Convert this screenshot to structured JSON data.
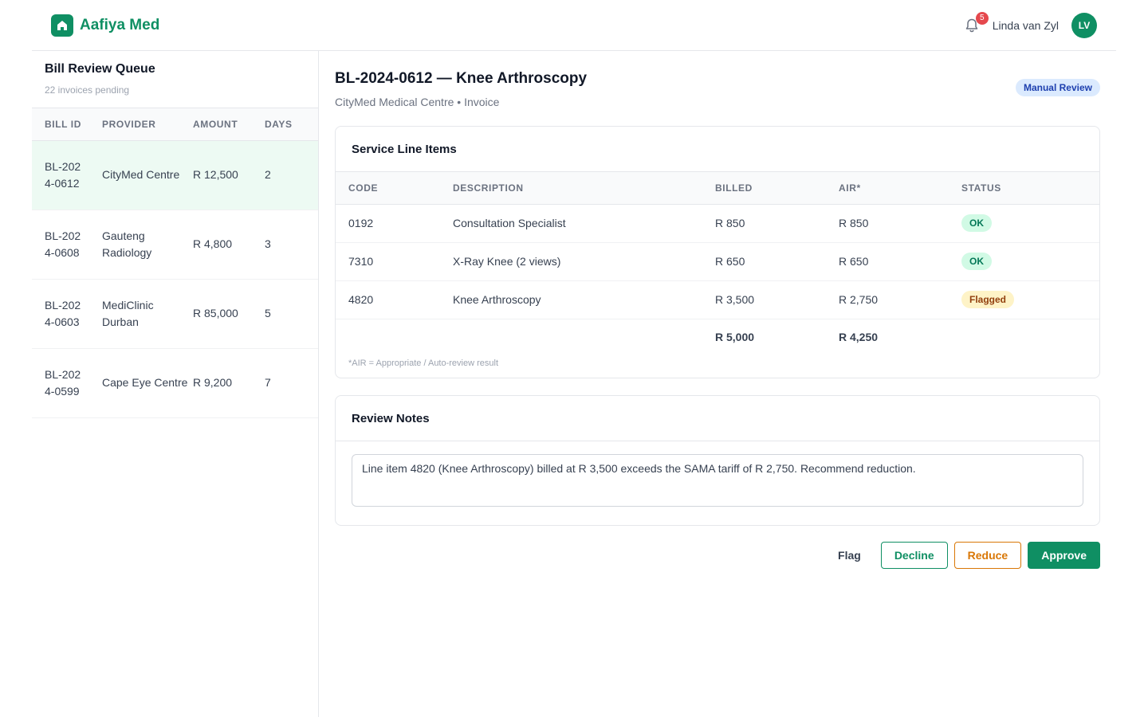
{
  "app": {
    "name": "Aafiya Med",
    "logo_icon": "home-icon",
    "brand_color": "#0f8f63"
  },
  "header": {
    "notification_count": "5",
    "user_name": "Linda van Zyl",
    "user_initials": "LV"
  },
  "queue": {
    "title": "Bill Review Queue",
    "subtitle": "22 invoices pending",
    "columns": [
      "BILL ID",
      "PROVIDER",
      "AMOUNT",
      "DAYS"
    ],
    "rows": [
      {
        "bill_id": "BL-2024-0612",
        "provider": "CityMed Centre",
        "amount": "R 12,500",
        "days": "2",
        "selected": true
      },
      {
        "bill_id": "BL-2024-0608",
        "provider": "Gauteng Radiology",
        "amount": "R 4,800",
        "days": "3",
        "selected": false
      },
      {
        "bill_id": "BL-2024-0603",
        "provider": "MediClinic Durban",
        "amount": "R 85,000",
        "days": "5",
        "selected": false
      },
      {
        "bill_id": "BL-2024-0599",
        "provider": "Cape Eye Centre",
        "amount": "R 9,200",
        "days": "7",
        "selected": false
      }
    ]
  },
  "detail": {
    "title": "BL-2024-0612 — Knee Arthroscopy",
    "subtitle": "CityMed Medical Centre • Invoice",
    "review_badge": "Manual Review",
    "line_items": {
      "title": "Service Line Items",
      "columns": [
        "CODE",
        "DESCRIPTION",
        "BILLED",
        "AIR*",
        "STATUS"
      ],
      "rows": [
        {
          "code": "0192",
          "description": "Consultation Specialist",
          "billed": "R 850",
          "air": "R 850",
          "status": "OK",
          "status_type": "ok"
        },
        {
          "code": "7310",
          "description": "X-Ray Knee (2 views)",
          "billed": "R 650",
          "air": "R 650",
          "status": "OK",
          "status_type": "ok"
        },
        {
          "code": "4820",
          "description": "Knee Arthroscopy",
          "billed": "R 3,500",
          "air": "R 2,750",
          "status": "Flagged",
          "status_type": "flagged"
        }
      ],
      "total_billed": "R 5,000",
      "total_air": "R 4,250",
      "footnote": "*AIR = Appropriate / Auto-review result"
    },
    "notes": {
      "title": "Review Notes",
      "text": "Line item 4820 (Knee Arthroscopy) billed at R 3,500 exceeds the SAMA tariff of R 2,750. Recommend reduction."
    },
    "actions": {
      "flag": "Flag",
      "decline": "Decline",
      "reduce": "Reduce",
      "approve": "Approve"
    }
  }
}
